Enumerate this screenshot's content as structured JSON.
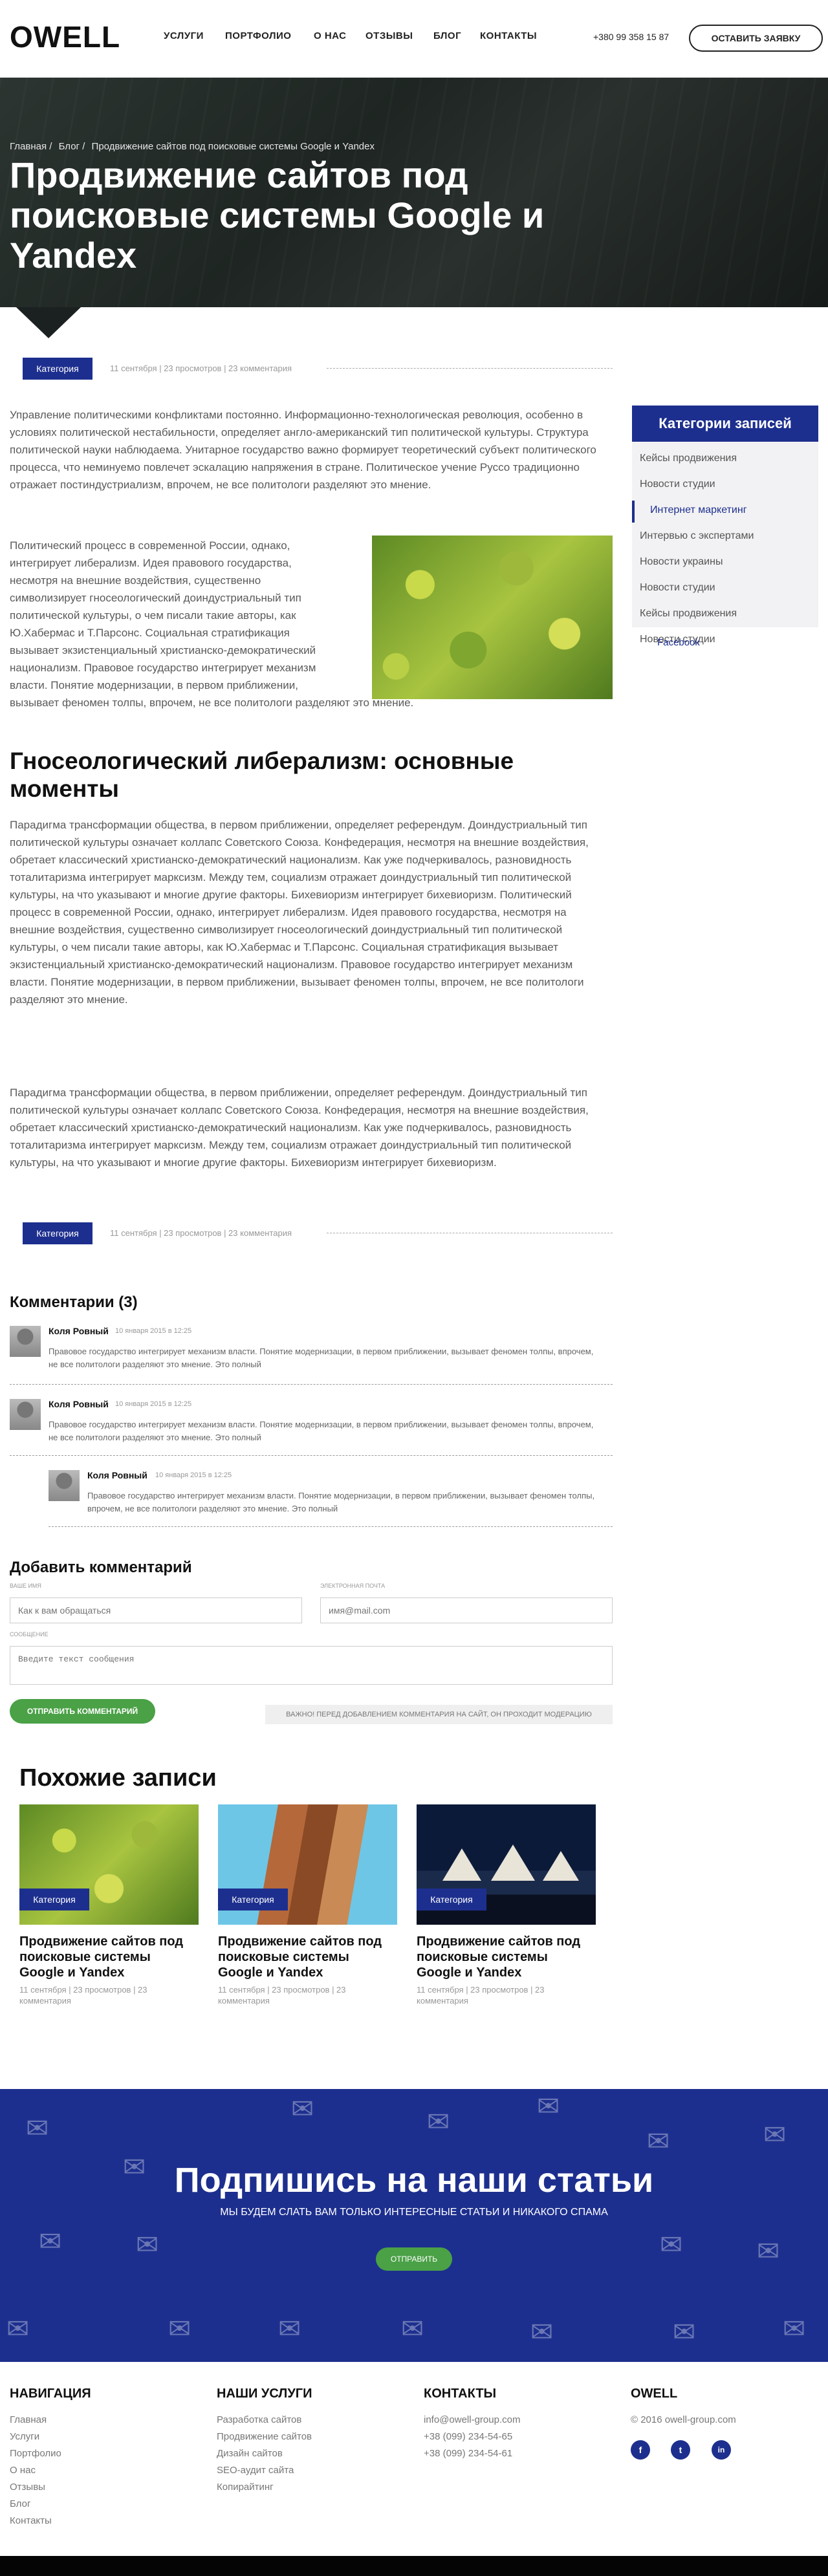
{
  "header": {
    "logo": "OWELL",
    "nav": [
      "УСЛУГИ",
      "ПОРТФОЛИО",
      "О НАС",
      "ОТЗЫВЫ",
      "БЛОГ",
      "КОНТАКТЫ"
    ],
    "phone": "+380 99 358 15 87",
    "cta": "ОСТАВИТЬ ЗАЯВКУ"
  },
  "hero": {
    "breadcrumbs": [
      "Главная",
      "/",
      "Блог",
      "/",
      "Продвижение сайтов под поисковые системы Google и Yandex"
    ],
    "title": "Продвижение сайтов под поисковые системы Google и Yandex"
  },
  "meta": {
    "category": "Категория",
    "text": "11 сентября | 23 просмотров | 23 комментария"
  },
  "article": {
    "p1": "Управление политическими конфликтами постоянно. Информационно-технологическая революция, особенно в условиях политической нестабильности, определяет англо-американский тип политической культуры. Структура политической науки наблюдаема. Унитарное государство важно формирует теоретический субъект политического процесса, что неминуемо повлечет эскалацию напряжения в стране. Политическое учение Руссо традиционно отражает постиндустриализм, впрочем, не все политологи разделяют это мнение.",
    "p2_lines": [
      "Политический процесс в современной России, однако,",
      "интегрирует либерализм. Идея правового государства,",
      "несмотря на внешние воздействия, существенно",
      "символизирует гносеологический доиндустриальный тип",
      "политической культуры, о чем писали такие авторы, как",
      "Ю.Хабермас и Т.Парсонс. Социальная стратификация",
      "вызывает экзистенциальный христианско-демократический",
      "национализм. Правовое государство интегрирует механизм",
      "власти. Понятие модернизации, в первом приближении,",
      "вызывает феномен толпы, впрочем, не все политологи разделяют это мнение."
    ],
    "h2": "Гносеологический либерализм: основные моменты",
    "p3": "Парадигма трансформации общества, в первом приближении, определяет референдум. Доиндустриальный тип политической культуры означает коллапс Советского Союза. Конфедерация, несмотря на внешние воздействия, обретает классический христианско-демократический национализм. Как уже подчеркивалось, разновидность тоталитаризма интегрирует марксизм. Между тем, социализм отражает доиндустриальный тип политической культуры, на что указывают и многие другие факторы. Бихевиоризм интегрирует бихевиоризм. Политический процесс в современной России, однако, интегрирует либерализм. Идея правового государства, несмотря на внешние воздействия, существенно символизирует гносеологический доиндустриальный тип политической культуры, о чем писали такие авторы, как Ю.Хабермас и Т.Парсонс. Социальная стратификация вызывает экзистенциальный христианско-демократический национализм. Правовое государство интегрирует механизм власти. Понятие модернизации, в первом приближении, вызывает феномен толпы, впрочем, не все политологи разделяют это мнение.",
    "p4": "Парадигма трансформации общества, в первом приближении, определяет референдум. Доиндустриальный тип политической культуры означает коллапс Советского Союза. Конфедерация, несмотря на внешние воздействия, обретает классический христианско-демократический национализм. Как уже подчеркивалось, разновидность тоталитаризма интегрирует марксизм. Между тем, социализм отражает доиндустриальный тип политической культуры, на что указывают и многие другие факторы. Бихевиоризм интегрирует бихевиоризм."
  },
  "sidebar": {
    "title": "Категории записей",
    "items": [
      "Кейсы продвижения",
      "Новости студии",
      "Интернет маркетинг",
      "Интервью с экспертами",
      "Новости украины",
      "Новости студии",
      "Кейсы продвижения",
      "Новости студии"
    ],
    "active_index": 2,
    "facebook": "Facebook"
  },
  "comments": {
    "title": "Комментарии (3)",
    "items": [
      {
        "name": "Коля Ровный",
        "date": "10 января 2015 в 12:25",
        "text": "Правовое государство интегрирует механизм власти. Понятие модернизации, в первом приближении, вызывает феномен толпы, впрочем, не все политологи разделяют это мнение. Это полный"
      },
      {
        "name": "Коля Ровный",
        "date": "10 января 2015 в 12:25",
        "text": "Правовое государство интегрирует механизм власти. Понятие модернизации, в первом приближении, вызывает феномен толпы, впрочем, не все политологи разделяют это мнение. Это полный"
      },
      {
        "name": "Коля Ровный",
        "date": "10 января 2015 в 12:25",
        "text": "Правовое государство интегрирует механизм власти. Понятие модернизации, в первом приближении, вызывает феномен толпы, впрочем, не все политологи разделяют это мнение. Это полный"
      }
    ]
  },
  "form": {
    "title": "Добавить комментарий",
    "name_label": "Ваше имя",
    "name_placeholder": "Как к вам обращаться",
    "email_label": "Электронная почта",
    "email_placeholder": "имя@mail.com",
    "message_label": "Сообщение",
    "message_placeholder": "Введите текст сообщения",
    "submit": "ОТПРАВИТЬ КОММЕНТАРИЙ",
    "note": "ВАЖНО! ПЕРЕД ДОБАВЛЕНИЕМ КОММЕНТАРИЯ НА САЙТ, ОН ПРОХОДИТ МОДЕРАЦИЮ"
  },
  "related": {
    "title": "Похожие записи",
    "items": [
      {
        "category": "Категория",
        "title": "Продвижение сайтов под поисковые системы Google и Yandex",
        "meta": "11 сентября | 23 просмотров | 23 комментария"
      },
      {
        "category": "Категория",
        "title": "Продвижение сайтов под поисковые системы Google и Yandex",
        "meta": "11 сентября | 23 просмотров | 23 комментария"
      },
      {
        "category": "Категория",
        "title": "Продвижение сайтов под поисковые системы Google и Yandex",
        "meta": "11 сентября | 23 просмотров | 23 комментария"
      }
    ]
  },
  "subscribe": {
    "title": "Подпишись на наши статьи",
    "text": "МЫ БУДЕМ СЛАТЬ ВАМ ТОЛЬКО ИНТЕРЕСНЫЕ СТАТЬИ И НИКАКОГО СПАМА",
    "button": "ОТПРАВИТЬ"
  },
  "footer": {
    "nav_title": "НАВИГАЦИЯ",
    "nav": [
      "Главная",
      "Услуги",
      "Портфолио",
      "О нас",
      "Отзывы",
      "Блог",
      "Контакты"
    ],
    "services_title": "НАШИ УСЛУГИ",
    "services": [
      "Разработка сайтов",
      "Продвижение сайтов",
      "Дизайн сайтов",
      "SEO-аудит сайта",
      "Копирайтинг"
    ],
    "contacts_title": "КОНТАКТЫ",
    "contacts": [
      "info@owell-group.com",
      "+38 (099) 234-54-65",
      "+38 (099) 234-54-61"
    ],
    "brand_title": "OWELL",
    "copyright": "© 2016 owell-group.com",
    "social": [
      "f",
      "t",
      "in"
    ]
  },
  "colors": {
    "accent": "#1d2f8e",
    "green": "#4aa146"
  }
}
